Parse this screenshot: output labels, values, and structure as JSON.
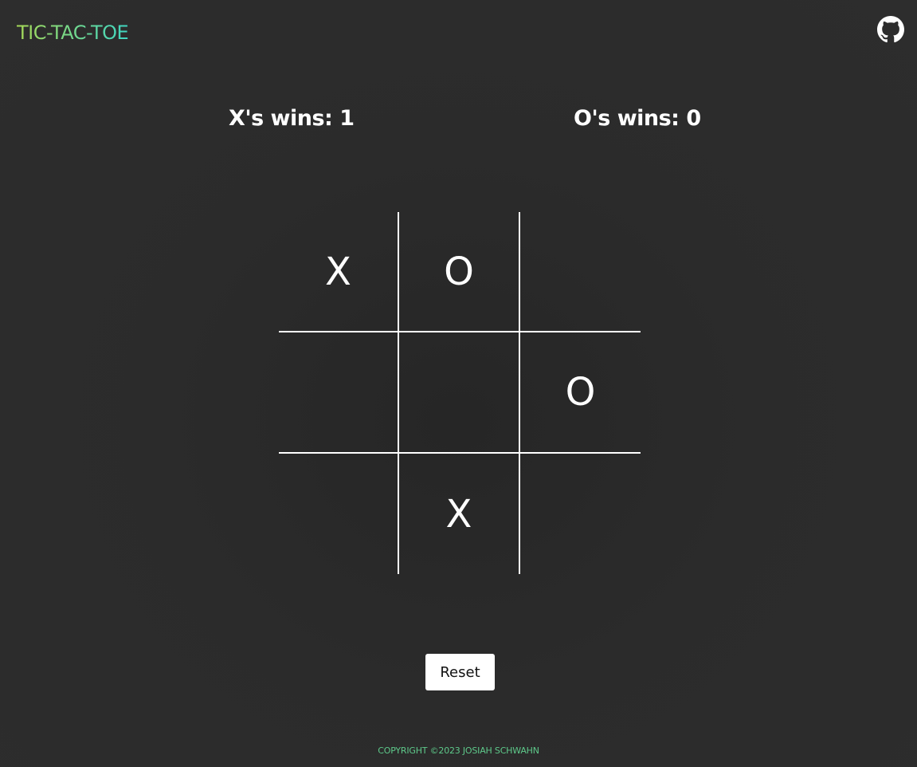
{
  "header": {
    "logo": "TIC-TAC-TOE",
    "github_icon": "github-icon"
  },
  "scores": {
    "x_label": "X's wins: 1",
    "o_label": "O's wins: 0"
  },
  "board": {
    "cells": [
      "X",
      "O",
      "",
      "",
      "",
      "O",
      "",
      "X",
      ""
    ]
  },
  "controls": {
    "reset_label": "Reset"
  },
  "footer": {
    "copyright": "COPYRIGHT ©2023 JOSIAH SCHWAHN"
  },
  "colors": {
    "background": "#2b2b2b",
    "logo_gradient_start": "#a6d957",
    "logo_gradient_end": "#3fd6c2",
    "footer_text": "#5ec98a",
    "grid_lines": "#ffffff"
  }
}
